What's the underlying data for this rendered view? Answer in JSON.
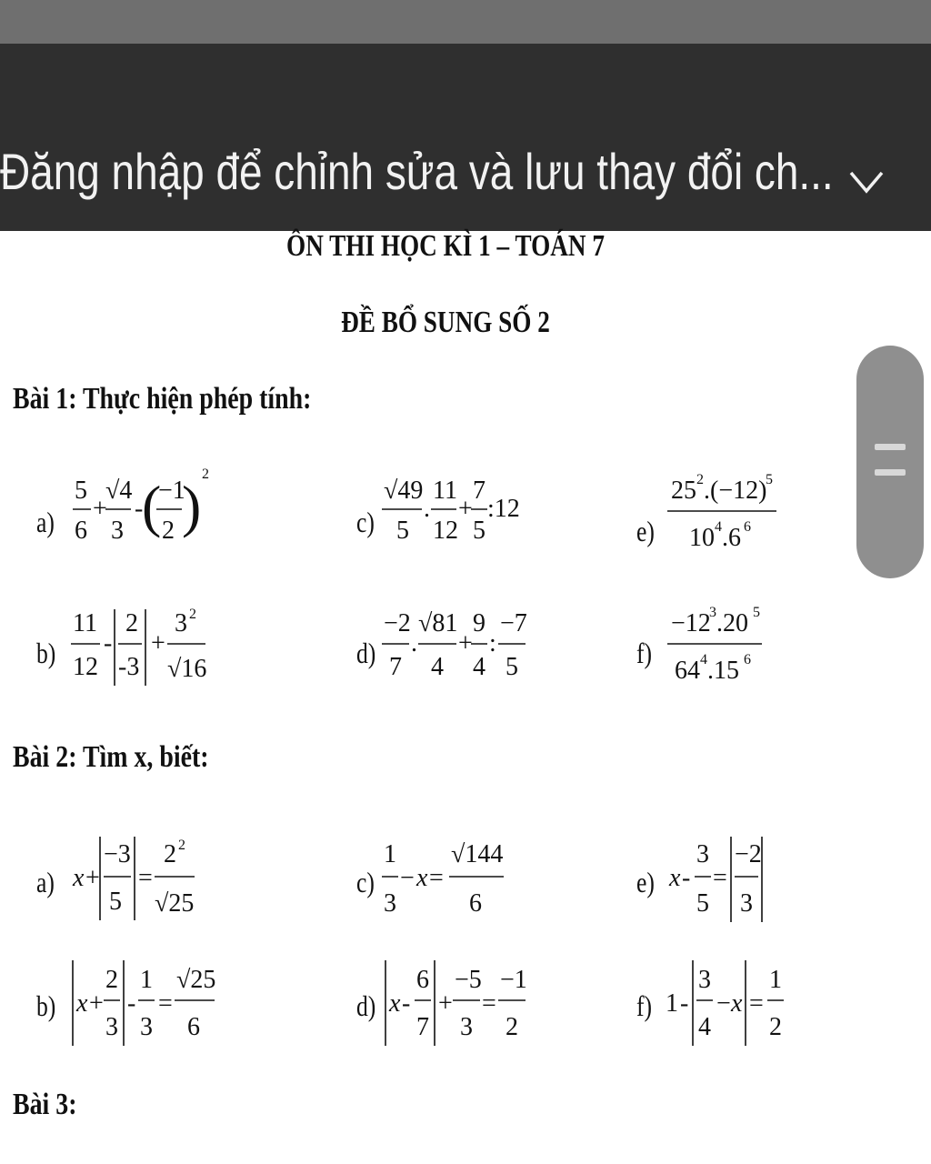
{
  "banner": {
    "title": "Đăng nhập để chỉnh sửa và lưu thay đổi ch..."
  },
  "document": {
    "title": "ÔN THI HỌC KÌ 1 – TOÁN 7",
    "subtitle": "ĐỀ BỔ SUNG SỐ 2",
    "exercise1": {
      "heading": "Bài 1: Thực hiện phép tính:",
      "items": [
        {
          "label": "a)",
          "expr": "5/6 + √4/3 − (−1/2)^2"
        },
        {
          "label": "b)",
          "expr": "11/12 − |2/−3| + 3^2/√16"
        },
        {
          "label": "c)",
          "expr": "√49/5 . 11/12 + 7/5 : 12"
        },
        {
          "label": "d)",
          "expr": "−2/7 . √81/4 + 9/4 : −7/5"
        },
        {
          "label": "e)",
          "expr": "25^2.(−12)^5 / 10^4.6^6"
        },
        {
          "label": "f)",
          "expr": "−12^3.20^5 / 64^4.15^6"
        }
      ]
    },
    "exercise2": {
      "heading": "Bài 2: Tìm x, biết:",
      "items": [
        {
          "label": "a)",
          "expr": "x + |−3/5| = 2^2/√25"
        },
        {
          "label": "b)",
          "expr": "|x + 2/3| − 1/3 = √25/6"
        },
        {
          "label": "c)",
          "expr": "1/3 − x = √144/6"
        },
        {
          "label": "d)",
          "expr": "|x − 6/7| + −5/3 = −1/2"
        },
        {
          "label": "e)",
          "expr": "x − 3/5 = |−2/3|"
        },
        {
          "label": "f)",
          "expr": "1 − |3/4 − x| = 1/2"
        }
      ]
    },
    "exercise3": {
      "heading": "Bài 3:"
    }
  },
  "icons": {
    "collapse": "chevron-down-icon",
    "scroll": "scroll-handle-icon"
  }
}
